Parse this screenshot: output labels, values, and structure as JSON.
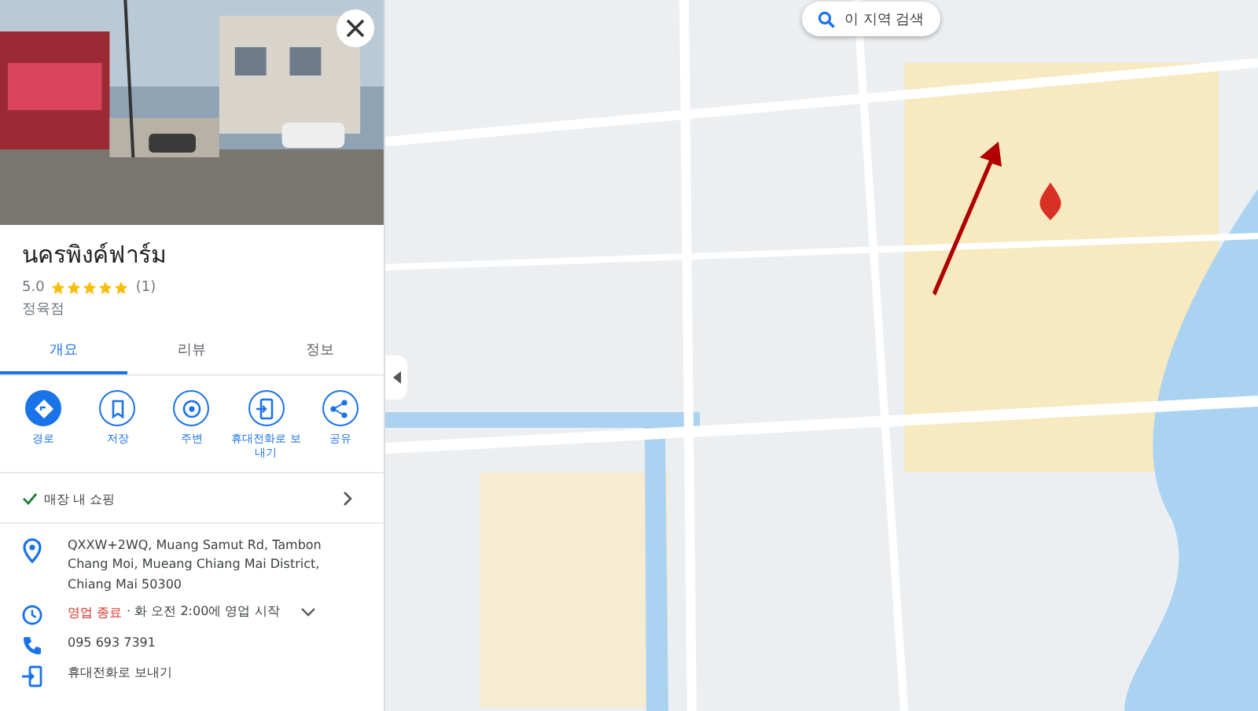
{
  "place": {
    "name": "นครพิงค์ฟาร์ม",
    "rating": "5.0",
    "stars": 5,
    "review_count": "(1)",
    "category": "정육점"
  },
  "tabs": [
    {
      "label": "개요",
      "selected": true
    },
    {
      "label": "리뷰",
      "selected": false
    },
    {
      "label": "정보",
      "selected": false
    }
  ],
  "actions": [
    {
      "label": "경로",
      "kind": "directions",
      "primary": true
    },
    {
      "label": "저장",
      "kind": "save",
      "primary": false
    },
    {
      "label": "주변",
      "kind": "nearby",
      "primary": false
    },
    {
      "label": "휴대전화로 보내기",
      "kind": "send",
      "primary": false
    },
    {
      "label": "공유",
      "kind": "share",
      "primary": false
    }
  ],
  "shopping": {
    "label": "매장 내 쇼핑",
    "checked": true
  },
  "details": [
    {
      "kind": "address",
      "text": "QXXW+2WQ, Muang Samut Rd, Tambon Chang Moi, Mueang Chiang Mai District, Chiang Mai 50300"
    },
    {
      "kind": "hours",
      "status": "영업 종료",
      "text": "· 화 오전 2:00에 영업 시작"
    },
    {
      "kind": "phone",
      "text": "095 693 7391"
    },
    {
      "kind": "send",
      "text": "휴대전화로 보내기"
    }
  ],
  "map": {
    "search_button": "이 지역 검색"
  }
}
